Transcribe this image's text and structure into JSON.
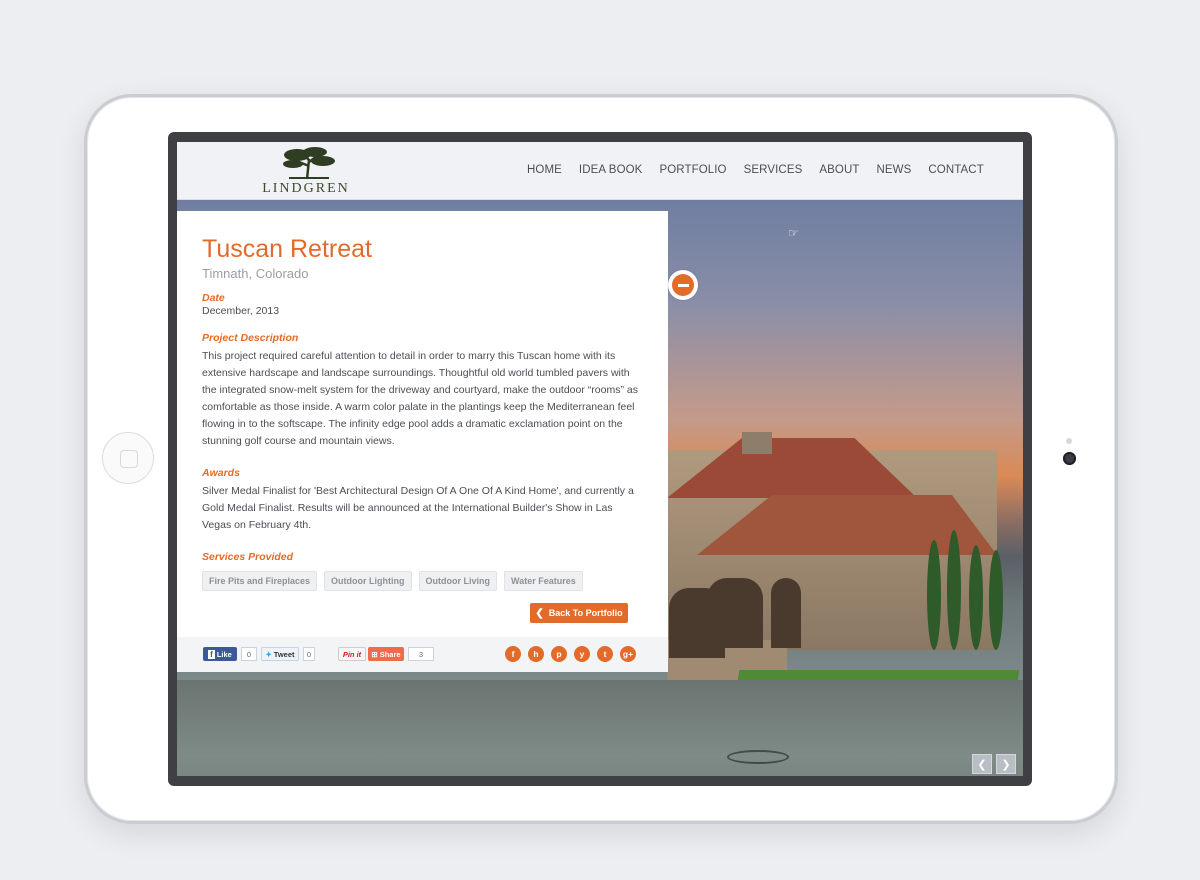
{
  "header": {
    "logo_text": "LINDGREN",
    "nav": [
      "HOME",
      "IDEA BOOK",
      "PORTFOLIO",
      "SERVICES",
      "ABOUT",
      "NEWS",
      "CONTACT"
    ]
  },
  "project": {
    "title": "Tuscan Retreat",
    "location": "Timnath, Colorado",
    "date_label": "Date",
    "date": "December, 2013",
    "description_label": "Project Description",
    "description": "This project required careful attention to detail in order to marry this Tuscan home with its extensive hardscape and landscape surroundings.  Thoughtful old world tumbled pavers with the integrated snow-melt system for the driveway and courtyard, make the outdoor “rooms” as comfortable as those inside.  A warm color palate in the plantings keep the Mediterranean feel flowing in to the softscape.  The infinity edge pool adds a dramatic exclamation point on the stunning golf course and mountain views.",
    "awards_label": "Awards",
    "awards": "Silver Medal Finalist for 'Best Architectural Design Of A One Of A Kind Home', and currently a Gold Medal Finalist.  Results will be announced at the International Builder's Show in Las Vegas on February 4th.",
    "services_label": "Services Provided",
    "services": [
      "Fire Pits and Fireplaces",
      "Outdoor Lighting",
      "Outdoor Living",
      "Water Features"
    ],
    "back_label": "Back To Portfolio"
  },
  "social": {
    "like_label": "Like",
    "like_count": "0",
    "tweet_label": "Tweet",
    "tweet_count": "0",
    "pin_label": "Pin it",
    "share_label": "Share",
    "share_count": "3",
    "icons": [
      "facebook-icon",
      "houzz-icon",
      "pinterest-icon",
      "yelp-icon",
      "twitter-icon",
      "google-plus-icon"
    ]
  },
  "colors": {
    "accent": "#e36b2a",
    "header_bg": "#f1f2f5",
    "nav_text": "#4a4f57"
  }
}
